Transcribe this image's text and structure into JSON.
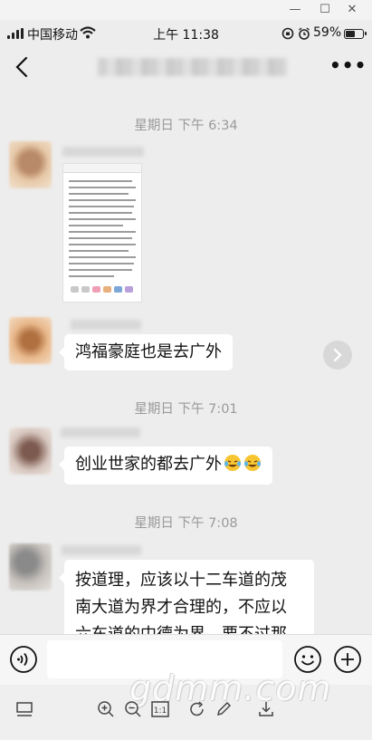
{
  "statusbar": {
    "carrier": "中国移动",
    "time": "上午 11:38",
    "battery_pct": "59%",
    "battery_level": 0.59
  },
  "header": {
    "more_label": "•••"
  },
  "chat": {
    "messages": [
      {
        "timestamp": "星期日 下午 6:34",
        "type": "image"
      },
      {
        "type": "text",
        "text": "鸿福豪庭也是去广外"
      },
      {
        "timestamp": "星期日 下午 7:01",
        "type": "text",
        "text": "创业世家的都去广外",
        "emoji": [
          "laughing-crying-emoji",
          "laughing-crying-emoji"
        ]
      },
      {
        "timestamp": "星期日 下午 7:08",
        "type": "text",
        "lines": [
          "按道理，应该以十二车道的茂",
          "南大道为界才合理的，不应以",
          "六车道的中德为界，要不过那"
        ]
      }
    ]
  },
  "inputbar": {
    "placeholder": "",
    "icons": [
      "voice-icon",
      "emoji-icon",
      "plus-icon"
    ]
  },
  "viewer": {
    "watermark": "gdmm.com",
    "zoom_ratio": "1:1",
    "tools": [
      "thumbnail-icon",
      "zoom-in-icon",
      "zoom-out-icon",
      "actual-size-icon",
      "rotate-icon",
      "edit-icon",
      "download-icon"
    ]
  },
  "colors": {
    "background": "#ededed",
    "bubble": "#ffffff",
    "timestamp": "#9a9a9a"
  }
}
